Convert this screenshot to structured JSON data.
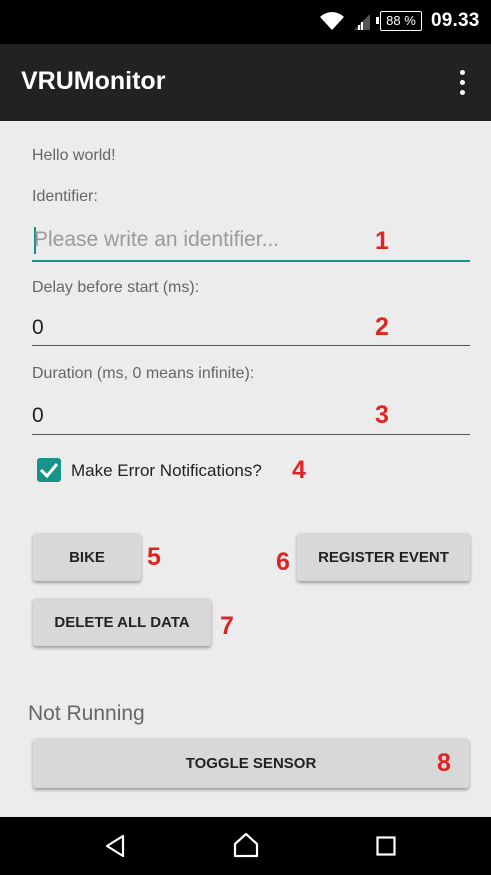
{
  "status_bar": {
    "battery": "88 %",
    "time": "09.33",
    "icons": [
      "wifi-icon",
      "signal-icon",
      "battery-icon"
    ]
  },
  "app_bar": {
    "title": "VRUMonitor",
    "menu_icon": "overflow-menu-icon"
  },
  "content": {
    "greeting": "Hello world!",
    "identifier_label": "Identifier:",
    "identifier_placeholder": "Please write an identifier...",
    "identifier_value": "",
    "delay_label": "Delay before start (ms):",
    "delay_value": "0",
    "duration_label": "Duration (ms, 0 means infinite):",
    "duration_value": "0",
    "error_notifications_label": "Make Error Notifications?",
    "error_notifications_checked": true,
    "bike_label": "BIKE",
    "register_event_label": "REGISTER EVENT",
    "delete_all_label": "DELETE ALL DATA",
    "status_text": "Not Running",
    "toggle_sensor_label": "TOGGLE SENSOR"
  },
  "annotations": [
    "1",
    "2",
    "3",
    "4",
    "5",
    "6",
    "7",
    "8"
  ],
  "colors": {
    "accent": "#16938a",
    "annotation": "#e02424",
    "app_bar": "#222222",
    "background": "#ececec"
  },
  "nav_bar": {
    "icons": [
      "back-icon",
      "home-icon",
      "recents-icon"
    ]
  }
}
